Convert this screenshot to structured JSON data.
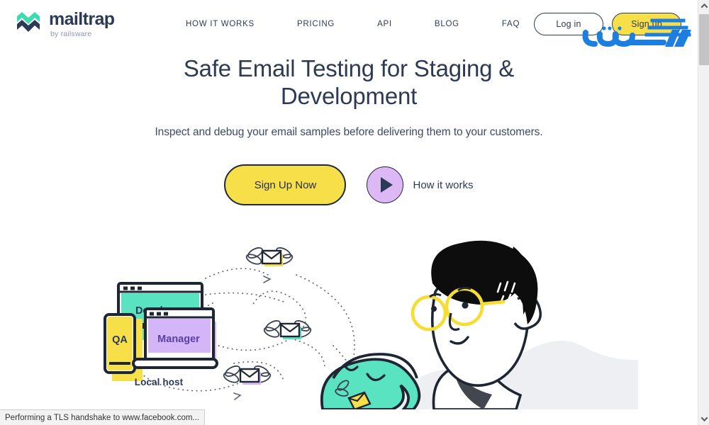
{
  "brand": {
    "name": "mailtrap",
    "tagline": "by railsware",
    "logo_icon": "mailtrap-hexagon-m-logo",
    "colors": {
      "teal": "#3DDCB0",
      "navy": "#2B3A57"
    }
  },
  "nav": {
    "items": [
      {
        "label": "HOW IT WORKS",
        "name": "nav-how-it-works"
      },
      {
        "label": "PRICING",
        "name": "nav-pricing"
      },
      {
        "label": "API",
        "name": "nav-api"
      },
      {
        "label": "BLOG",
        "name": "nav-blog"
      },
      {
        "label": "FAQ",
        "name": "nav-faq"
      }
    ]
  },
  "header_actions": {
    "login_label": "Log in",
    "signup_label": "Sign up"
  },
  "watermark": {
    "text": "جویومن",
    "color": "#1C7FE0"
  },
  "hero": {
    "title": "Safe Email Testing for Staging & Development",
    "subtitle": "Inspect and debug your email samples before delivering them to your customers.",
    "cta_primary_label": "Sign Up Now",
    "cta_secondary_label": "How it works",
    "play_icon": "play-triangle-icon"
  },
  "illustration": {
    "developer_label": "Developer",
    "qa_label": "QA",
    "manager_label": "Manager",
    "localhost_label": "Local host",
    "colors": {
      "teal": "#5AE3C0",
      "yellow": "#F7DF4A",
      "purple": "#D4B5F7",
      "ink": "#1F2633",
      "label_navy": "#2B3A57",
      "label_purple": "#5B3FA8"
    }
  },
  "browser": {
    "status_text": "Performing a TLS handshake to www.facebook.com...",
    "scrollbar_up_icon": "chevron-up-icon",
    "scrollbar_down_icon": "chevron-down-icon"
  }
}
